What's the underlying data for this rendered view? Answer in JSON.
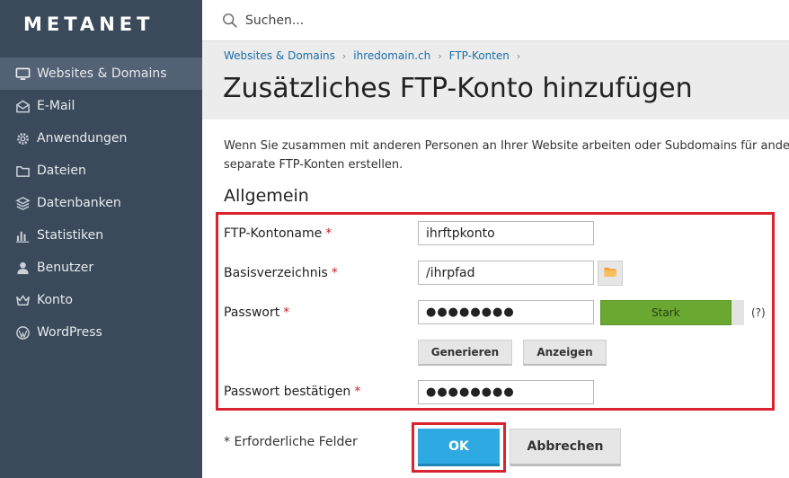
{
  "sidebar": {
    "logo": "METANET",
    "items": [
      {
        "label": "Websites & Domains",
        "icon": "monitor-icon",
        "active": true
      },
      {
        "label": "E-Mail",
        "icon": "mail-icon"
      },
      {
        "label": "Anwendungen",
        "icon": "gear-icon"
      },
      {
        "label": "Dateien",
        "icon": "folder-icon"
      },
      {
        "label": "Datenbanken",
        "icon": "database-icon"
      },
      {
        "label": "Statistiken",
        "icon": "bar-chart-icon"
      },
      {
        "label": "Benutzer",
        "icon": "user-icon"
      },
      {
        "label": "Konto",
        "icon": "crown-icon"
      },
      {
        "label": "WordPress",
        "icon": "wordpress-icon"
      }
    ]
  },
  "search": {
    "placeholder": "Suchen..."
  },
  "breadcrumb": [
    "Websites & Domains",
    "ihredomain.ch",
    "FTP-Konten"
  ],
  "page": {
    "title": "Zusätzliches FTP-Konto hinzufügen",
    "intro_line1": "Wenn Sie zusammen mit anderen Personen an Ihrer Website arbeiten oder Subdomains für ande",
    "intro_line2": "separate FTP-Konten erstellen.",
    "section": "Allgemein"
  },
  "form": {
    "ftp_name_label": "FTP-Kontoname",
    "ftp_name_value": "ihrftpkonto",
    "base_dir_label": "Basisverzeichnis",
    "base_dir_value": "/ihrpfad",
    "password_label": "Passwort",
    "password_value": "●●●●●●●●",
    "strength_label": "Stark",
    "strength_level": 0.91,
    "help": "(?)",
    "generate_label": "Generieren",
    "show_label": "Anzeigen",
    "confirm_label": "Passwort bestätigen",
    "confirm_value": "●●●●●●●●",
    "required_mark": "*"
  },
  "footer": {
    "required_note": "* Erforderliche Felder",
    "ok_label": "OK",
    "cancel_label": "Abbrechen"
  },
  "colors": {
    "sidebar_bg": "#3b4a5a",
    "active_item": "#526174",
    "link": "#1a6ea8",
    "highlight": "#d9232e",
    "ok_button": "#2fa9e1",
    "strength_fill": "#6aa832"
  }
}
